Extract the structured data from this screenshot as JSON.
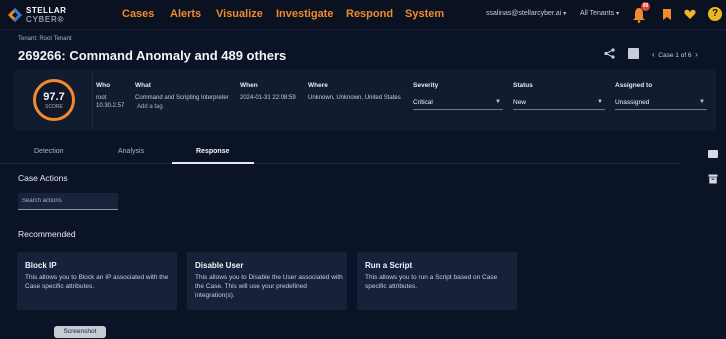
{
  "brand": {
    "line1": "STELLAR",
    "line2": "CYBER®"
  },
  "nav": {
    "items": [
      "Cases",
      "Alerts",
      "Visualize",
      "Investigate",
      "Respond",
      "System"
    ],
    "user": "ssalinas@stellarcyber.ai",
    "tenants": "All Tenants",
    "notification_count": "99",
    "accent": "#f08a2b"
  },
  "header": {
    "tenant": "Tenant: Root Tenant",
    "title": "269266: Command Anomaly and 489 others",
    "pager": "Case 1 of 6"
  },
  "summary": {
    "score_value": "97.7",
    "score_label": "SCORE",
    "who_label": "Who",
    "who_value": "root",
    "who_ip": "10.30.2.57",
    "what_label": "What",
    "what_value": "Command and Scripting Interpreter",
    "add_tag": "Add a tag",
    "when_label": "When",
    "when_value": "2024-01-31 22:08:59",
    "where_label": "Where",
    "where_value": "Unknown, Unknown, United States",
    "severity_label": "Severity",
    "severity_value": "Critical",
    "status_label": "Status",
    "status_value": "New",
    "assigned_label": "Assigned to",
    "assigned_value": "Unassigned"
  },
  "tabs": [
    "Detection",
    "Analysis",
    "Response"
  ],
  "actions": {
    "title": "Case Actions",
    "search_placeholder": "Search actions",
    "recommended_title": "Recommended",
    "cards": [
      {
        "title": "Block IP",
        "desc": "This allows you to Block an IP associated with the Case specific attributes."
      },
      {
        "title": "Disable User",
        "desc": "This allows you to Disable the User associated with the Case. This will use your predefined integration(s)."
      },
      {
        "title": "Run a Script",
        "desc": "This allows you to run a Script based on Case specific attributes."
      }
    ]
  },
  "tooltip": "Screenshot",
  "icons": [
    "share-icon",
    "image-icon",
    "chevron-left-icon",
    "chevron-right-icon",
    "bell-icon",
    "bookmark-icon",
    "heart-icon",
    "help-icon",
    "chat-icon",
    "trash-icon"
  ]
}
